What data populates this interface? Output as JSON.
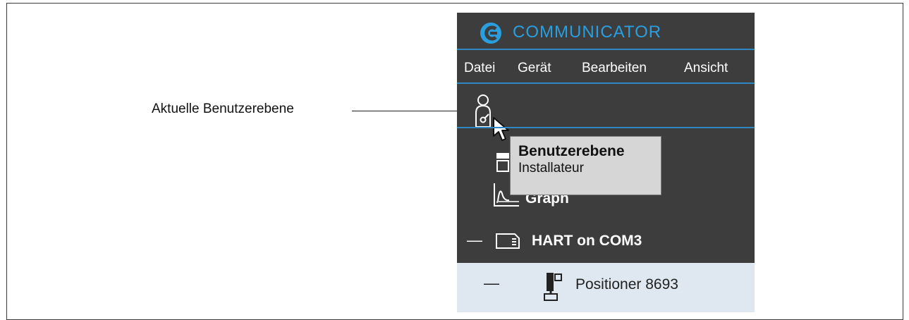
{
  "callout": {
    "label": "Aktuelle Benutzerebene"
  },
  "app": {
    "title": "COMMUNICATOR",
    "accent_color": "#2a9fe0",
    "menu": [
      "Datei",
      "Gerät",
      "Bearbeiten",
      "Ansicht"
    ]
  },
  "toolbar": {
    "user_level_icon": "user-key-icon"
  },
  "tree": {
    "items": [
      {
        "label": "",
        "icon": "window-icon"
      },
      {
        "label": "Graph",
        "icon": "graph-icon"
      },
      {
        "label": "HART on COM3",
        "icon": "folder-icon",
        "collapse": "—"
      }
    ],
    "selected": {
      "label": "Positioner 8693",
      "icon": "positioner-icon",
      "collapse": "—"
    }
  },
  "tooltip": {
    "title": "Benutzerebene",
    "value": "Installateur"
  }
}
